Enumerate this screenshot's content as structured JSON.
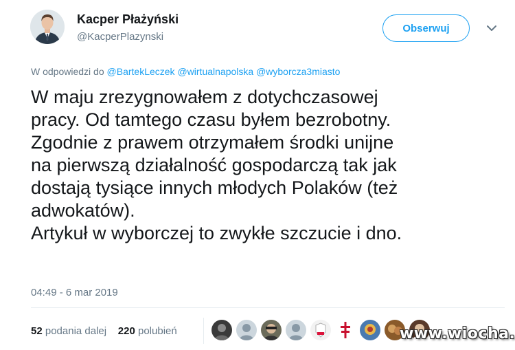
{
  "author": {
    "name": "Kacper Płażyński",
    "handle": "@KacperPlazynski"
  },
  "follow_label": "Obserwuj",
  "reply_to": {
    "prefix": "W odpowiedzi do",
    "mentions": [
      "@BartekLeczek",
      "@wirtualnapolska",
      "@wyborcza3miasto"
    ]
  },
  "tweet_lines": [
    "W maju zrezygnowałem z dotychczasowej",
    "pracy. Od tamtego czasu byłem bezrobotny.",
    "Zgodnie z prawem otrzymałem środki unijne",
    "na pierwszą działalność gospodarczą tak jak",
    "dostają tysiące innych młodych Polaków (też",
    "adwokatów).",
    "Artykuł w wyborczej to zwykłe szczucie i dno."
  ],
  "timestamp": "04:49 - 6 mar 2019",
  "stats": {
    "retweets_count": "52",
    "retweets_label": "podania dalej",
    "likes_count": "220",
    "likes_label": "polubień"
  },
  "watermark": "www.wiocha.pl",
  "colors": {
    "accent": "#1da1f2",
    "secondary_text": "#657786",
    "primary_text": "#14171a"
  },
  "icons": {
    "menu": "chevron-down-icon"
  }
}
